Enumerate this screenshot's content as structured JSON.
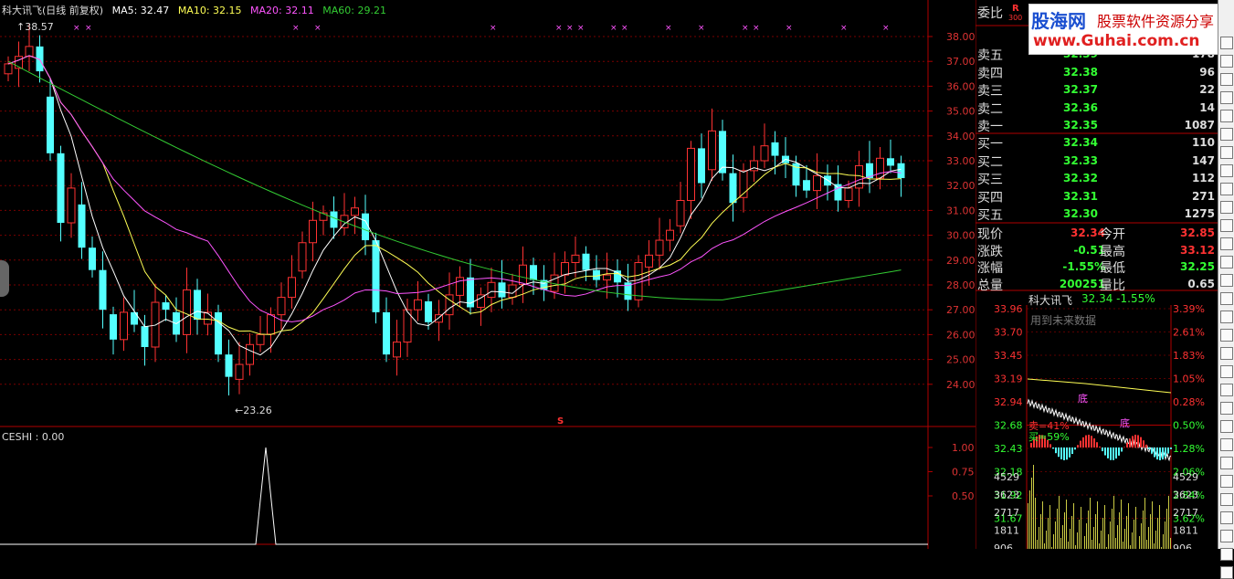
{
  "main": {
    "title": "科大讯飞(日线 前复权)",
    "ma5": "MA5: 32.47",
    "ma10": "MA10: 32.15",
    "ma20": "MA20: 32.11",
    "ma60": "MA60: 29.21",
    "high_marker": "38.57",
    "low_marker": "←23.26",
    "s_marker": "S",
    "y_ticks": [
      "38.00",
      "37.00",
      "36.00",
      "35.00",
      "34.00",
      "33.00",
      "32.00",
      "31.00",
      "30.00",
      "29.00",
      "28.00",
      "27.00",
      "26.00",
      "25.00",
      "24.00"
    ],
    "sub_title": "CESHI : 0.00",
    "sub_ticks": [
      "1.00",
      "0.75",
      "0.50"
    ],
    "colors": {
      "up": "#ff3232",
      "down": "#54ffff",
      "ma5": "#ffffff",
      "ma10": "#ffff55",
      "ma20": "#ff55ff",
      "ma60": "#33cc33"
    }
  },
  "orderbook": {
    "header": "委比",
    "sells": [
      {
        "label": "卖五",
        "price": "32.39",
        "vol": "178"
      },
      {
        "label": "卖四",
        "price": "32.38",
        "vol": "96"
      },
      {
        "label": "卖三",
        "price": "32.37",
        "vol": "22"
      },
      {
        "label": "卖二",
        "price": "32.36",
        "vol": "14"
      },
      {
        "label": "卖一",
        "price": "32.35",
        "vol": "1087"
      }
    ],
    "buys": [
      {
        "label": "买一",
        "price": "32.34",
        "vol": "110"
      },
      {
        "label": "买二",
        "price": "32.33",
        "vol": "147"
      },
      {
        "label": "买三",
        "price": "32.32",
        "vol": "112"
      },
      {
        "label": "买四",
        "price": "32.31",
        "vol": "271"
      },
      {
        "label": "买五",
        "price": "32.30",
        "vol": "1275"
      }
    ],
    "stats": [
      {
        "l1": "现价",
        "v1": "32.34",
        "l2": "今开",
        "v2": "32.85"
      },
      {
        "l1": "涨跌",
        "v1": "-0.51",
        "l2": "最高",
        "v2": "33.12"
      },
      {
        "l1": "涨幅",
        "v1": "-1.55%",
        "l2": "最低",
        "v2": "32.25"
      },
      {
        "l1": "总量",
        "v1": "200251",
        "l2": "量比",
        "v2": "0.65"
      }
    ]
  },
  "mini": {
    "name": "科大讯飞",
    "quote": "32.34 -1.55%",
    "note": "用到未来数据",
    "left_ticks": [
      "33.96",
      "33.70",
      "33.45",
      "33.19",
      "32.94",
      "32.68",
      "32.43",
      "32.18",
      "31.92",
      "31.67"
    ],
    "right_ticks": [
      "3.39%",
      "2.61%",
      "1.83%",
      "1.05%",
      "0.28%",
      "0.50%",
      "1.28%",
      "2.06%",
      "2.84%",
      "3.62%"
    ],
    "vol_left": [
      "4529",
      "3623",
      "2717",
      "1811",
      "906"
    ],
    "vol_right": [
      "4529",
      "3623",
      "2717",
      "1811",
      "906"
    ],
    "tag_bottom": "底",
    "tag_sell": "卖=41%",
    "tag_buy": "买=59%"
  },
  "logo": {
    "site": "股海网",
    "slogan": "股票软件资源分享",
    "url": "www.Guhai.com.cn",
    "corner": "R",
    "corner_sub": "300"
  }
}
